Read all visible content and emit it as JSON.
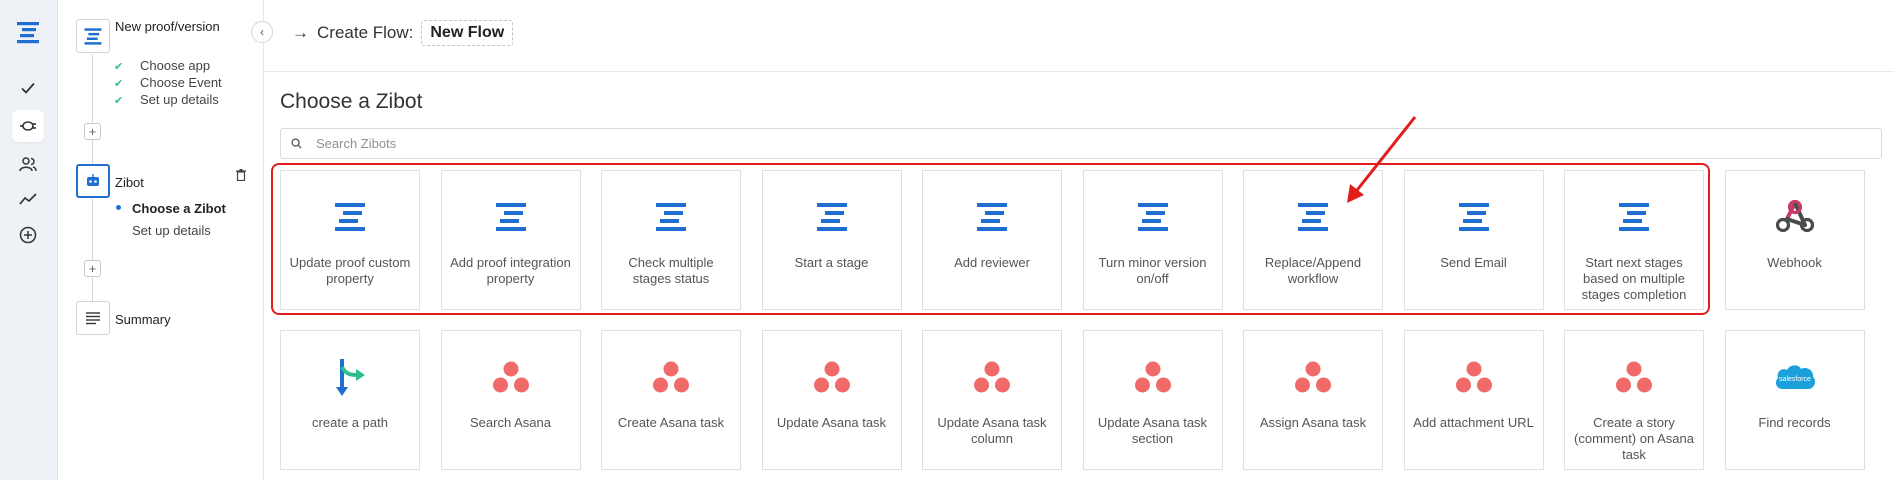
{
  "header": {
    "crumb_arrow": "→",
    "crumb_label": "Create Flow:",
    "flow_name": "New Flow"
  },
  "steps": {
    "trigger": {
      "title": "New proof/version",
      "subs": [
        "Choose app",
        "Choose Event",
        "Set up details"
      ]
    },
    "zibot": {
      "title": "Zibot",
      "active_sub": "Choose a Zibot",
      "sub": "Set up details"
    },
    "summary": {
      "title": "Summary"
    }
  },
  "main": {
    "heading": "Choose a Zibot",
    "search_placeholder": "Search Zibots"
  },
  "colors": {
    "brand_blue": "#1e6fd0",
    "highlight_red": "#e31c1c",
    "asana_coral": "#f06a6a",
    "check_green": "#2fbe8f"
  },
  "cards_row1": [
    {
      "label": "Update proof custom property",
      "icon": "zibot-logo-icon"
    },
    {
      "label": "Add proof integration property",
      "icon": "zibot-logo-icon"
    },
    {
      "label": "Check multiple stages status",
      "icon": "zibot-logo-icon"
    },
    {
      "label": "Start a stage",
      "icon": "zibot-logo-icon"
    },
    {
      "label": "Add reviewer",
      "icon": "zibot-logo-icon"
    },
    {
      "label": "Turn minor version on/off",
      "icon": "zibot-logo-icon"
    },
    {
      "label": "Replace/Append workflow",
      "icon": "zibot-logo-icon"
    },
    {
      "label": "Send Email",
      "icon": "zibot-logo-icon"
    },
    {
      "label": "Start next stages based on multiple stages completion",
      "icon": "zibot-logo-icon"
    },
    {
      "label": "Webhook",
      "icon": "webhook-icon"
    }
  ],
  "cards_row2": [
    {
      "label": "create a path",
      "icon": "path-split-icon"
    },
    {
      "label": "Search Asana",
      "icon": "asana-icon"
    },
    {
      "label": "Create Asana task",
      "icon": "asana-icon"
    },
    {
      "label": "Update Asana task",
      "icon": "asana-icon"
    },
    {
      "label": "Update Asana task column",
      "icon": "asana-icon"
    },
    {
      "label": "Update Asana task section",
      "icon": "asana-icon"
    },
    {
      "label": "Assign Asana task",
      "icon": "asana-icon"
    },
    {
      "label": "Add attachment URL",
      "icon": "asana-icon"
    },
    {
      "label": "Create a story (comment) on Asana task",
      "icon": "asana-icon"
    },
    {
      "label": "Find records",
      "icon": "salesforce-icon"
    }
  ],
  "salesforce_text": "salesforce"
}
